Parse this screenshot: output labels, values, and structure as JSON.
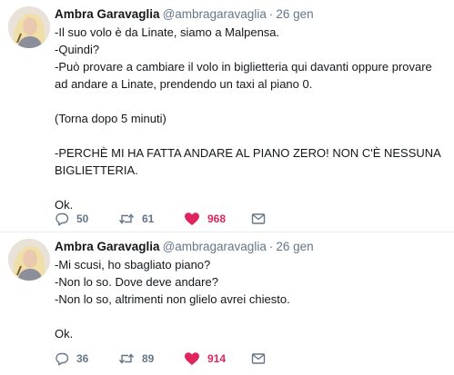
{
  "colors": {
    "text": "#14171a",
    "secondary": "#657786",
    "like": "#e0245e",
    "divider": "#e6ecf0"
  },
  "icons": {
    "reply": "reply-icon",
    "retweet": "retweet-icon",
    "like": "heart-icon",
    "dm": "envelope-icon"
  },
  "tweets": [
    {
      "author": {
        "name": "Ambra Garavaglia",
        "handle": "@ambragaravaglia"
      },
      "separator": "·",
      "time": "26 gen",
      "lines": [
        "-Il suo volo è da Linate, siamo a Malpensa.",
        "-Quindi?",
        "-Può provare a cambiare il volo in biglietteria qui davanti oppure provare ad andare a Linate, prendendo un taxi al piano 0.",
        "",
        "(Torna dopo 5 minuti)",
        "",
        "-PERCHÈ MI HA FATTA ANDARE AL PIANO ZERO! NON C'È NESSUNA BIGLIETTERIA.",
        "",
        "Ok."
      ],
      "stats": {
        "replies": "50",
        "retweets": "61",
        "likes": "968"
      }
    },
    {
      "author": {
        "name": "Ambra Garavaglia",
        "handle": "@ambragaravaglia"
      },
      "separator": "·",
      "time": "26 gen",
      "lines": [
        "-Mi scusi, ho sbagliato piano?",
        "-Non lo so. Dove deve andare?",
        "-Non lo so, altrimenti non glielo avrei chiesto.",
        "",
        "Ok."
      ],
      "stats": {
        "replies": "36",
        "retweets": "89",
        "likes": "914"
      }
    }
  ]
}
